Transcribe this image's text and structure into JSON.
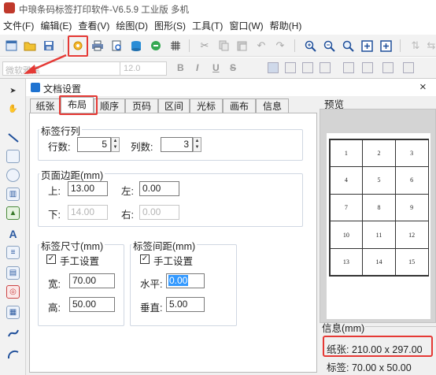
{
  "app": {
    "title": "中琅条码标签打印软件-V6.5.9 工业版 多机"
  },
  "menu": [
    "文件(F)",
    "编辑(E)",
    "查看(V)",
    "绘图(D)",
    "图形(S)",
    "工具(T)",
    "窗口(W)",
    "帮助(H)"
  ],
  "toolbar_icons": [
    "new-icon",
    "open-icon",
    "save-icon",
    "doc-settings-icon",
    "print-icon",
    "print-preview-icon",
    "database-icon",
    "connect-icon",
    "grid-icon",
    "cut-icon",
    "copy-icon",
    "paste-icon",
    "undo-icon",
    "redo-icon",
    "zoom-in-icon",
    "zoom-out-icon",
    "zoom-fit-icon",
    "zoom-page-icon",
    "zoom-width-icon"
  ],
  "format_bar": {
    "font": "微软雅黑",
    "font_size": "12.0",
    "buttons": [
      "B",
      "I",
      "U",
      "S"
    ]
  },
  "dialog": {
    "title": "文档设置",
    "close": "×",
    "tabs": [
      "纸张",
      "布局",
      "顺序",
      "页码",
      "区间",
      "光标",
      "画布",
      "信息"
    ],
    "active_tab": "布局",
    "rows_cols": {
      "legend": "标签行列",
      "rows_label": "行数:",
      "rows": "5",
      "cols_label": "列数:",
      "cols": "3"
    },
    "margins": {
      "legend": "页面边距(mm)",
      "top_label": "上:",
      "top": "13.00",
      "left_label": "左:",
      "left": "0.00",
      "bottom_label": "下:",
      "bottom": "14.00",
      "right_label": "右:",
      "right": "0.00"
    },
    "label_size": {
      "legend": "标签尺寸(mm)",
      "manual_label": "手工设置",
      "manual_checked": true,
      "width_label": "宽:",
      "width": "70.00",
      "height_label": "高:",
      "height": "50.00"
    },
    "label_gap": {
      "legend": "标签间距(mm)",
      "manual_label": "手工设置",
      "manual_checked": true,
      "h_label": "水平:",
      "h": "0.00",
      "v_label": "垂直:",
      "v": "5.00"
    },
    "preview": {
      "title": "预览",
      "cells": [
        "1",
        "2",
        "3",
        "4",
        "5",
        "6",
        "7",
        "8",
        "9",
        "10",
        "11",
        "12",
        "13",
        "14",
        "15"
      ]
    },
    "info": {
      "title": "信息(mm)",
      "paper": "纸张: 210.00 x 297.00",
      "label": "标签: 70.00 x 50.00"
    }
  },
  "colors": {
    "highlight_red": "#e53935",
    "accent_blue": "#1f73d1",
    "selection_blue": "#3399ff"
  }
}
